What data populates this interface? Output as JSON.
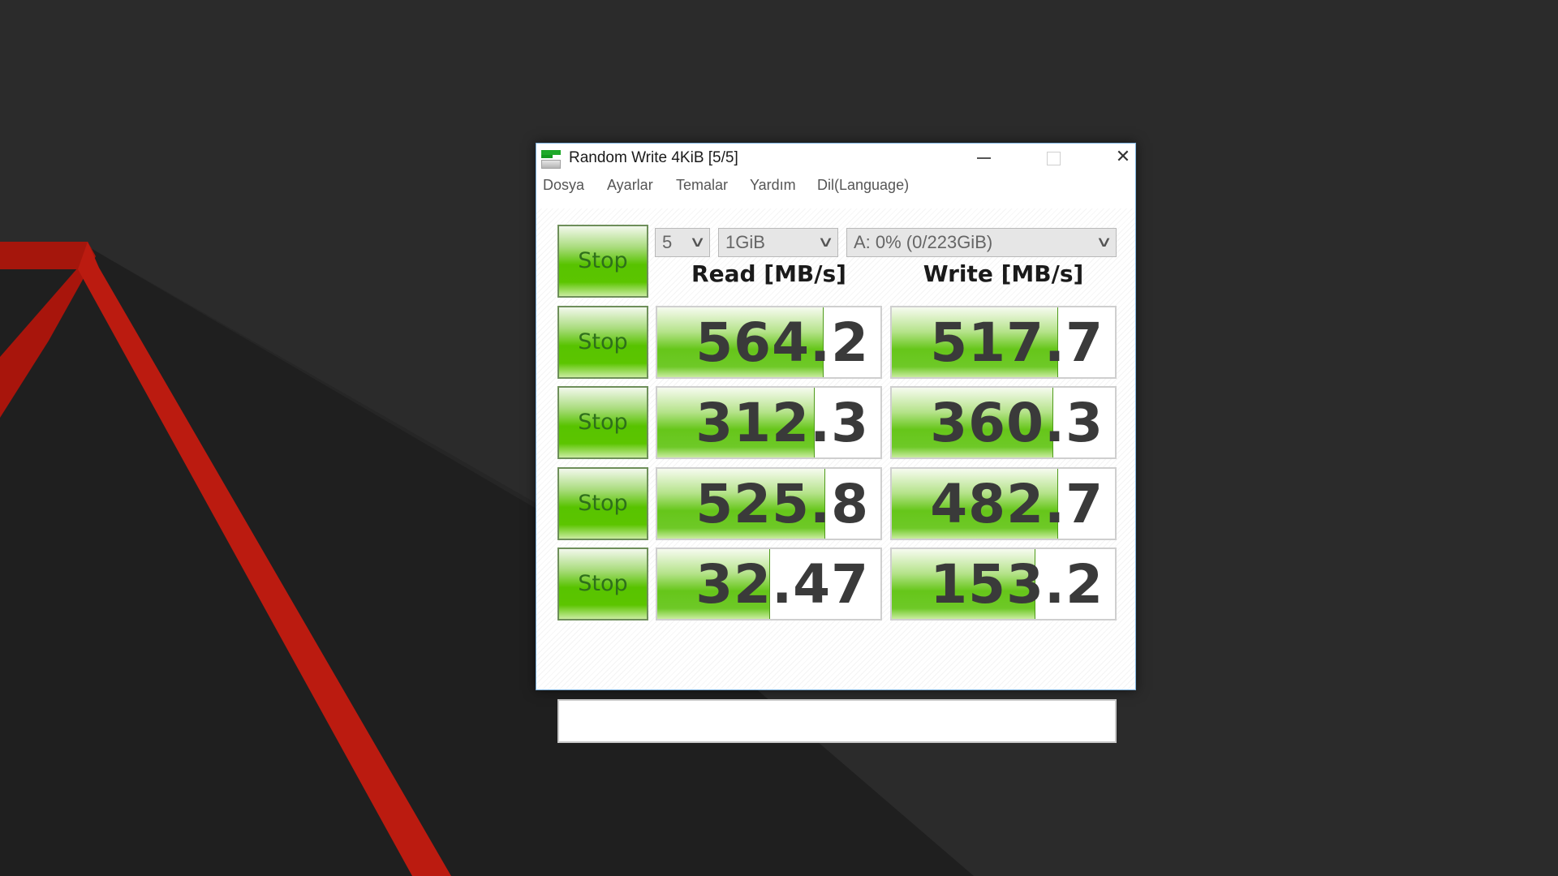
{
  "desktop": {
    "background_color": "#262626",
    "accent_color": "#b81a10"
  },
  "window": {
    "title": "Random Write 4KiB [5/5]",
    "app_icon": "disk-benchmark-icon",
    "controls": {
      "minimize": "minimize-icon",
      "maximize": "maximize-icon",
      "close": "close-icon",
      "close_glyph": "✕"
    }
  },
  "menu": {
    "items": [
      {
        "label": "Dosya"
      },
      {
        "label": "Ayarlar"
      },
      {
        "label": "Temalar"
      },
      {
        "label": "Yardım"
      },
      {
        "label": "Dil(Language)"
      }
    ]
  },
  "toolbar": {
    "all_button_label": "Stop",
    "count_select": {
      "value": "5"
    },
    "size_select": {
      "value": "1GiB"
    },
    "drive_select": {
      "value": "A: 0% (0/223GiB)"
    },
    "chevron": "∨"
  },
  "columns": {
    "read": "Read [MB/s]",
    "write": "Write [MB/s]"
  },
  "rows": [
    {
      "button_label": "Stop",
      "read": "564.2",
      "write": "517.7",
      "read_fill": 0.74,
      "write_fill": 0.74
    },
    {
      "button_label": "Stop",
      "read": "312.3",
      "write": "360.3",
      "read_fill": 0.7,
      "write_fill": 0.72
    },
    {
      "button_label": "Stop",
      "read": "525.8",
      "write": "482.7",
      "read_fill": 0.75,
      "write_fill": 0.74
    },
    {
      "button_label": "Stop",
      "read": "32.47",
      "write": "153.2",
      "read_fill": 0.5,
      "write_fill": 0.64
    }
  ],
  "status_text": ""
}
